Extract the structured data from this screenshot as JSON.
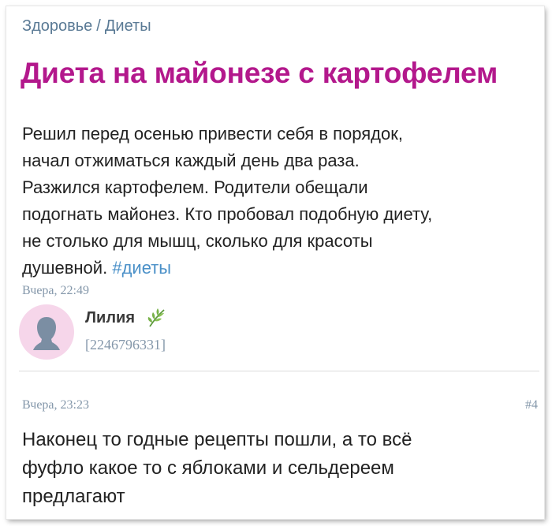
{
  "breadcrumb": {
    "parent": "Здоровье",
    "separator": "/",
    "current": "Диеты"
  },
  "post": {
    "title": "Диета на майонезе с картофелем",
    "body_lines": [
      "Решил перед осенью привести себя в порядок,",
      "начал отжиматься каждый день два раза.",
      "Разжился картофелем. Родители обещали",
      "подогнать майонез. Кто пробовал подобную диету,",
      "не столько для мышц, сколько для красоты",
      "душевной."
    ],
    "hashtag": "#диеты",
    "timestamp": "Вчера, 22:49",
    "author": {
      "name": "Лилия",
      "id": "[2246796331]",
      "badge_icon": "leaf-icon"
    }
  },
  "reply": {
    "timestamp": "Вчера, 23:23",
    "number": "#4",
    "text_lines": [
      "Наконец то годные рецепты пошли, а то всё",
      "фуфло какое то с яблоками и сельдереем",
      "предлагают"
    ]
  },
  "colors": {
    "title": "#b3188c",
    "link": "#4a90c8",
    "muted": "#8497aa",
    "breadcrumb": "#5a7a95",
    "avatar_bg": "#f6d6ea",
    "text": "#222222"
  }
}
